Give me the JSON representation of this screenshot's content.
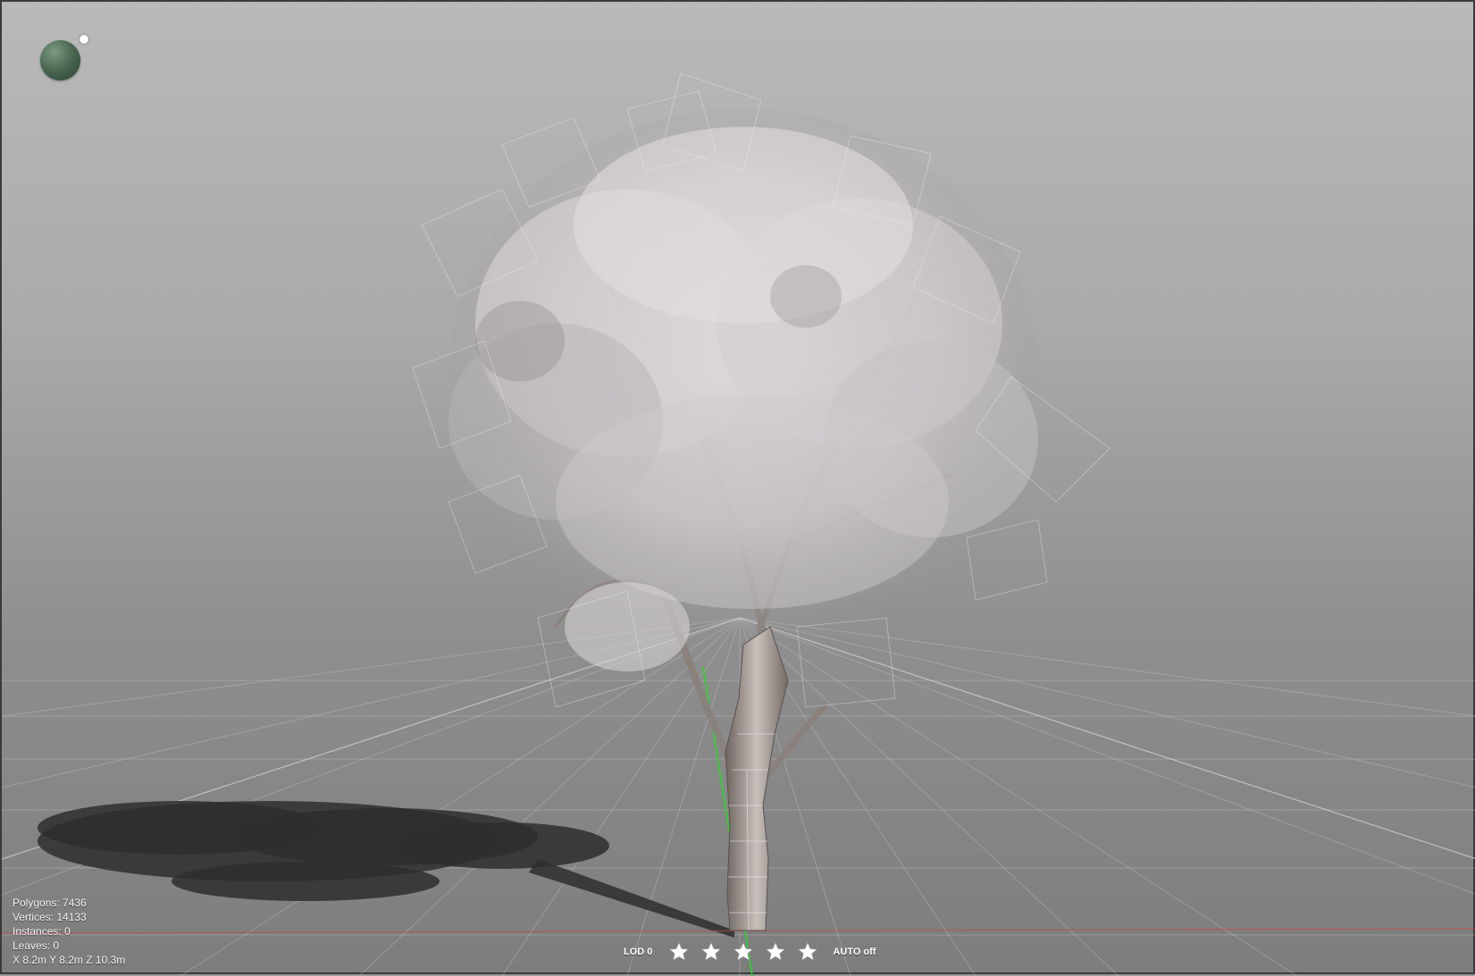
{
  "stats": {
    "polygons": "Polygons: 7436",
    "vertices": "Vertices: 14133",
    "instances": "Instances: 0",
    "leaves": "Leaves: 0",
    "dimensions": "X 8.2m Y 8.2m Z 10.3m"
  },
  "toolbar": {
    "lod_label": "LOD 0",
    "lod_levels": 5,
    "auto_label": "AUTO off"
  },
  "colors": {
    "background_top": "#b9b9b9",
    "background_bottom": "#7d7d7d",
    "grid": "#cfcfcf",
    "axis_x": "#c84a4a",
    "axis_y": "#22dd22",
    "light_sphere": "#4c6a54"
  }
}
